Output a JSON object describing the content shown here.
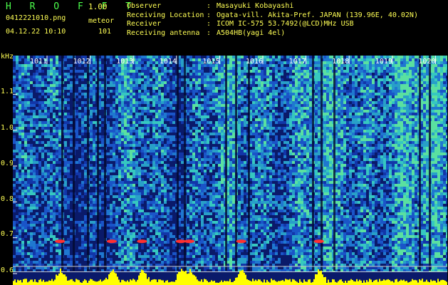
{
  "header": {
    "app_title": "H R O F F T",
    "app_version": "1.00",
    "file_name": "0412221010.png",
    "mode": "meteor",
    "datetime": "04.12.22 10:10",
    "meteor_count": "101",
    "info": [
      {
        "label": "Observer",
        "sep": ":",
        "value": "Masayuki Kobayashi"
      },
      {
        "label": "Receiving Location",
        "sep": ":",
        "value": "Ogata-vill. Akita-Pref. JAPAN (139.96E, 40.02N)"
      },
      {
        "label": "Receiver",
        "sep": ":",
        "value": "ICOM IC-575 53.7492(@LCD)MHz USB"
      },
      {
        "label": "Receiving antenna",
        "sep": ":",
        "value": "A504HB(yagi 4el)"
      }
    ]
  },
  "colors": {
    "title": "#4cff4c",
    "text": "#ffff55",
    "background": "#000000",
    "spectrum_low": "#0a1a6a",
    "spectrum_high": "#40e0d0",
    "echo": "#ff3030",
    "amplitude": "#ffff00"
  },
  "chart_data": {
    "type": "heatmap",
    "ylabel": "kHz",
    "x_ticks": [
      "1011",
      "1012",
      "1013",
      "1014",
      "1015",
      "1016",
      "1017",
      "1018",
      "1019",
      "1020"
    ],
    "y_ticks": [
      "1.1",
      "1.0",
      "0.9",
      "0.8",
      "0.7",
      "0.6"
    ],
    "ylim": [
      0.6,
      1.2
    ],
    "echo_frequency_khz": 0.69,
    "echo_times": [
      1011.3,
      1012.5,
      1013.2,
      1014.1,
      1014.3,
      1015.5,
      1017.3
    ]
  }
}
